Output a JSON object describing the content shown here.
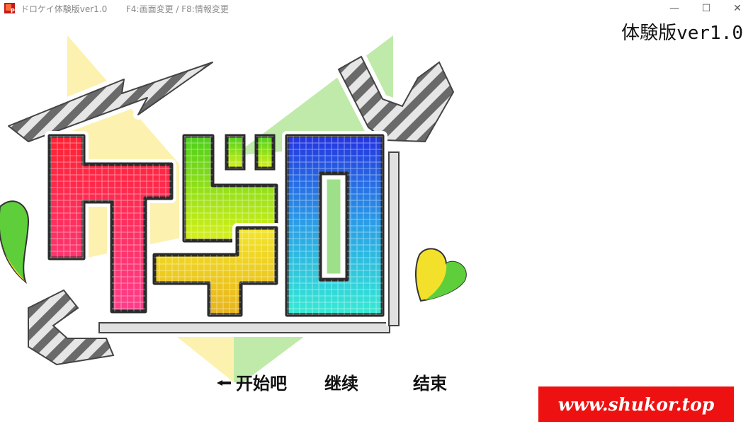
{
  "window": {
    "title": "ドロケイ体験版ver1.0",
    "hint": "F4:画面変更 / F8:情報変更",
    "icon": "app-icon",
    "controls": {
      "minimize": "—",
      "maximize": "☐",
      "close": "✕"
    }
  },
  "version_label": "体験版ver1.0",
  "logo": {
    "text": "ドロケイ",
    "colors": {
      "red": "#ff2a55",
      "green": "#7ad41a",
      "yellow": "#f0cf1a",
      "blue": "#2a4adf",
      "cyan": "#2fe0d8",
      "outline": "#2b2b2b"
    }
  },
  "menu": {
    "start": "开始吧",
    "continue": "继续",
    "end": "结束",
    "selected_index": 0
  },
  "watermark": {
    "text": "www.shukor.top",
    "bg_color": "#ee1111"
  }
}
